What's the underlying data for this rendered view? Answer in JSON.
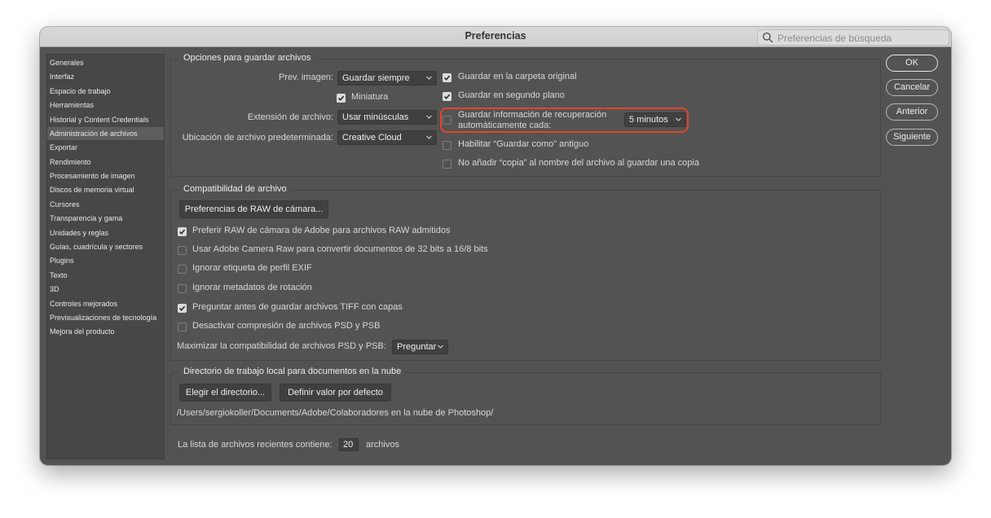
{
  "window": {
    "title": "Preferencias"
  },
  "search": {
    "placeholder": "Preferencias de búsqueda"
  },
  "sidebar": {
    "items": [
      {
        "label": "Generales"
      },
      {
        "label": "Interfaz"
      },
      {
        "label": "Espacio de trabajo"
      },
      {
        "label": "Herramientas"
      },
      {
        "label": "Historial y Content Credentials"
      },
      {
        "label": "Administración de archivos",
        "active": true
      },
      {
        "label": "Exportar"
      },
      {
        "label": "Rendimiento"
      },
      {
        "label": "Procesamiento de imagen"
      },
      {
        "label": "Discos de memoria virtual"
      },
      {
        "label": "Cursores"
      },
      {
        "label": "Transparencia y gama"
      },
      {
        "label": "Unidades y reglas"
      },
      {
        "label": "Guías, cuadrícula y sectores"
      },
      {
        "label": "Plugins"
      },
      {
        "label": "Texto"
      },
      {
        "label": "3D"
      },
      {
        "label": "Controles mejorados"
      },
      {
        "label": "Previsualizaciones de tecnología"
      },
      {
        "label": "Mejora del producto"
      }
    ]
  },
  "save_options": {
    "title": "Opciones para guardar archivos",
    "preview_label": "Prev. imagen:",
    "preview_value": "Guardar siempre",
    "thumbnail_label": "Miniatura",
    "thumbnail_checked": true,
    "extension_label": "Extensión de archivo:",
    "extension_value": "Usar minúsculas",
    "location_label": "Ubicación de archivo predeterminada:",
    "location_value": "Creative Cloud",
    "save_original_label": "Guardar en la carpeta original",
    "save_original_checked": true,
    "background_label": "Guardar en segundo plano",
    "background_checked": true,
    "autosave_label_line1": "Guardar información de recuperación",
    "autosave_label_line2": "automáticamente cada:",
    "autosave_checked": false,
    "autosave_interval": "5 minutos",
    "legacy_save_as_label": "Habilitar “Guardar como” antiguo",
    "legacy_save_as_checked": false,
    "no_copy_label": "No añadir “copia” al nombre del archivo al guardar una copia",
    "no_copy_checked": false
  },
  "compatibility": {
    "title": "Compatibilidad de archivo",
    "raw_prefs_button": "Preferencias de RAW de cámara...",
    "options": [
      {
        "label": "Preferir RAW de cámara de Adobe para archivos RAW admitidos",
        "checked": true
      },
      {
        "label": "Usar Adobe Camera Raw para convertir documentos de 32 bits a 16/8 bits",
        "checked": false
      },
      {
        "label": "Ignorar etiqueta de perfil EXIF",
        "checked": false
      },
      {
        "label": "Ignorar metadatos de rotación",
        "checked": false
      },
      {
        "label": "Preguntar antes de guardar archivos TIFF con capas",
        "checked": true
      },
      {
        "label": "Desactivar compresión de archivos PSD y PSB",
        "checked": false
      }
    ],
    "maximize_label": "Maximizar la compatibilidad de archivos PSD y PSB:",
    "maximize_value": "Preguntar"
  },
  "cloud_dir": {
    "title": "Directorio de trabajo local para documentos en la nube",
    "choose_button": "Elegir el directorio...",
    "default_button": "Definir valor por defecto",
    "path": "/Users/sergiokoller/Documents/Adobe/Colaboradores en la nube de Photoshop/"
  },
  "recent": {
    "label": "La lista de archivos recientes contiene:",
    "value": "20",
    "unit": "archivos"
  },
  "actions": {
    "ok": "OK",
    "cancel": "Cancelar",
    "previous": "Anterior",
    "next": "Siguiente"
  },
  "colors": {
    "window_bg": "#535353",
    "highlight": "#e0452c"
  }
}
